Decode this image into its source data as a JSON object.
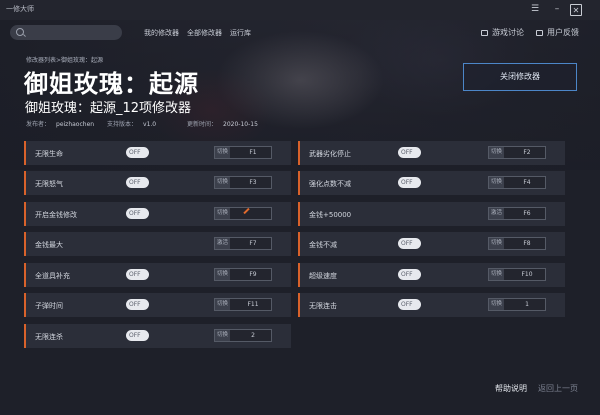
{
  "app": {
    "title": "一修大师"
  },
  "window_controls": {
    "menu": "☰",
    "minimize": "–",
    "maximize": "□",
    "close": "✕"
  },
  "search": {
    "placeholder": ""
  },
  "nav": {
    "my_modifiers": "我的修改器",
    "all_modifiers": "全部修改器",
    "runtime": "运行库"
  },
  "top_actions": {
    "discussion": "游戏讨论",
    "feedback": "用户反馈"
  },
  "breadcrumb": "修改器列表>御姐玫瑰：起源",
  "game": {
    "title": "御姐玫瑰：起源",
    "subtitle": "御姐玫瑰：起源_12项修改器",
    "publisher_label": "发布者：",
    "publisher": "peizhaochen",
    "version_label": "支持版本：",
    "version": "v1.0",
    "updated_label": "更新时间：",
    "updated": "2020-10-15"
  },
  "close_button": "关闭修改器",
  "cheats": [
    {
      "label": "无限生命",
      "toggle": "OFF",
      "mode": "切换",
      "key": "F1"
    },
    {
      "label": "武器劣化停止",
      "toggle": "OFF",
      "mode": "切换",
      "key": "F2"
    },
    {
      "label": "无限怒气",
      "toggle": "OFF",
      "mode": "切换",
      "key": "F3"
    },
    {
      "label": "强化点数不减",
      "toggle": "OFF",
      "mode": "切换",
      "key": "F4"
    },
    {
      "label": "开启金钱修改",
      "toggle": "OFF",
      "mode": "切换",
      "key": ""
    },
    {
      "label": "金钱+50000",
      "toggle": "",
      "mode": "激活",
      "key": "F6"
    },
    {
      "label": "金钱最大",
      "toggle": "",
      "mode": "激活",
      "key": "F7"
    },
    {
      "label": "金钱不减",
      "toggle": "OFF",
      "mode": "切换",
      "key": "F8"
    },
    {
      "label": "全道具补充",
      "toggle": "OFF",
      "mode": "切换",
      "key": "F9"
    },
    {
      "label": "超级速度",
      "toggle": "OFF",
      "mode": "切换",
      "key": "F10"
    },
    {
      "label": "子弹时间",
      "toggle": "OFF",
      "mode": "切换",
      "key": "F11"
    },
    {
      "label": "无限连击",
      "toggle": "OFF",
      "mode": "切换",
      "key": "1"
    },
    {
      "label": "无限连杀",
      "toggle": "OFF",
      "mode": "切换",
      "key": "2"
    }
  ],
  "footer": {
    "help": "帮助说明",
    "back": "返回上一页"
  },
  "colors": {
    "accent": "#d9622b",
    "button_border": "#4c86c8",
    "row_bg": "#2b2e39"
  }
}
